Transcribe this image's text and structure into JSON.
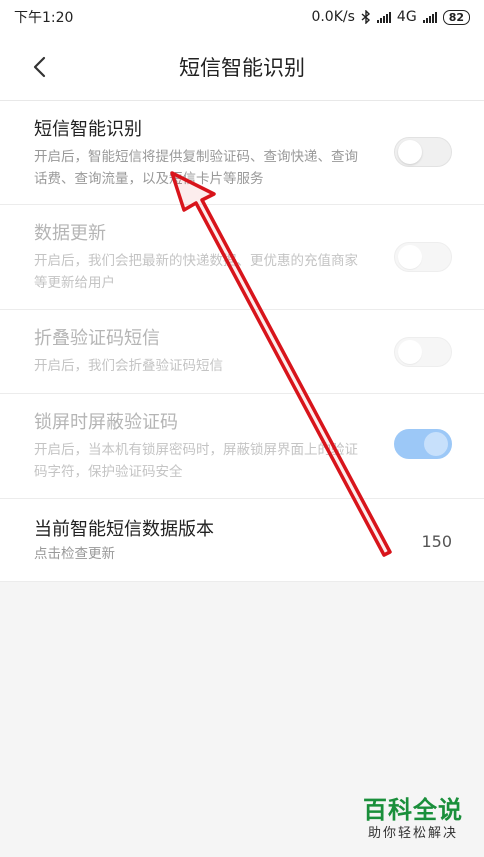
{
  "status_bar": {
    "time": "下午1:20",
    "speed": "0.0K/s",
    "network": "4G",
    "battery": "82"
  },
  "header": {
    "title": "短信智能识别"
  },
  "settings": [
    {
      "title": "短信智能识别",
      "description": "开启后，智能短信将提供复制验证码、查询快递、查询话费、查询流量，以及短信卡片等服务",
      "toggle": "off",
      "enabled": true
    },
    {
      "title": "数据更新",
      "description": "开启后，我们会把最新的快递数据、更优惠的充值商家等更新给用户",
      "toggle": "off",
      "enabled": false
    },
    {
      "title": "折叠验证码短信",
      "description": "开启后，我们会折叠验证码短信",
      "toggle": "off",
      "enabled": false
    },
    {
      "title": "锁屏时屏蔽验证码",
      "description": "开启后，当本机有锁屏密码时，屏蔽锁屏界面上的验证码字符，保护验证码安全",
      "toggle": "on",
      "enabled": false
    }
  ],
  "version": {
    "title": "当前智能短信数据版本",
    "description": "点击检查更新",
    "value": "150"
  },
  "watermark": {
    "main": "百科全说",
    "sub": "助你轻松解决"
  },
  "colors": {
    "toggle_on": "#9cc8f7",
    "annotation_arrow": "#d8141b",
    "watermark": "#1a8f3b"
  }
}
